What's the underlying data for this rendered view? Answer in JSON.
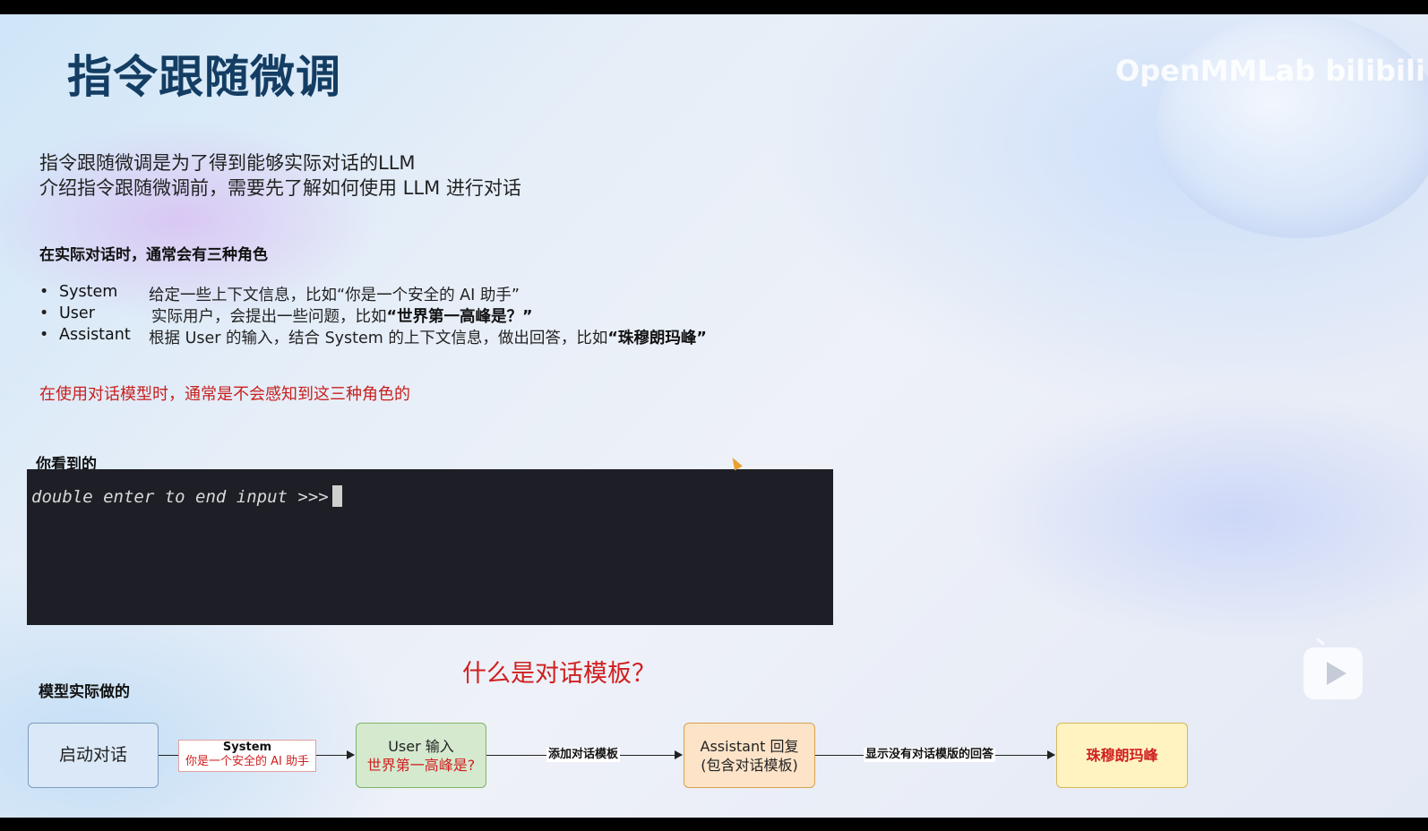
{
  "slide": {
    "title": "指令跟随微调",
    "watermark": "OpenMMLab bilibili",
    "intro_line1": "指令跟随微调是为了得到能够实际对话的LLM",
    "intro_line2": "介绍指令跟随微调前，需要先了解如何使用 LLM 进行对话",
    "roles_heading": "在实际对话时，通常会有三种角色",
    "roles": [
      {
        "bullet": "•",
        "name": "System",
        "desc": "给定一些上下文信息，比如“你是一个安全的 AI 助手”",
        "emph": ""
      },
      {
        "bullet": "•",
        "name": "User",
        "desc": "实际用户，会提出一些问题，比如",
        "emph": "“世界第一高峰是？”"
      },
      {
        "bullet": "•",
        "name": "Assistant",
        "desc": "根据 User 的输入，结合 System 的上下文信息，做出回答，比如",
        "emph": "“珠穆朗玛峰”"
      }
    ],
    "warning": "在使用对话模型时，通常是不会感知到这三种角色的",
    "you_see_label": "你看到的",
    "terminal_prompt": "double enter to end input >>>",
    "question": "什么是对话模板？",
    "model_does_label": "模型实际做的",
    "flow": {
      "start": "启动对话",
      "system_title": "System",
      "system_text": "你是一个安全的 AI 助手",
      "user_title": "User 输入",
      "user_text": "世界第一高峰是?",
      "edge_template": "添加对话模板",
      "assistant_title": "Assistant 回复",
      "assistant_text": "(包含对话模板)",
      "edge_display": "显示没有对话模版的回答",
      "answer": "珠穆朗玛峰"
    }
  }
}
